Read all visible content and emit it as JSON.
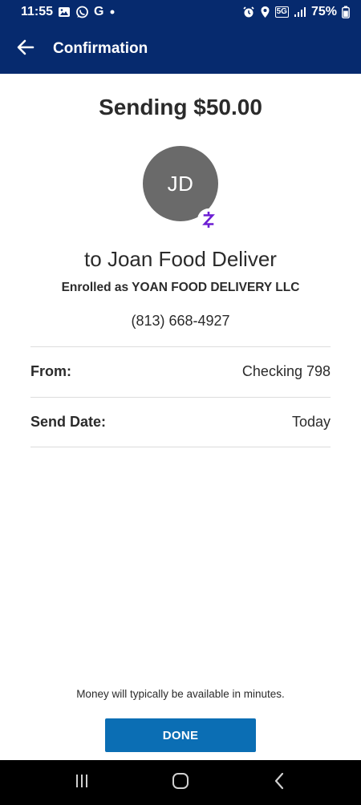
{
  "status_bar": {
    "time": "11:55",
    "left_icons": [
      "gallery-icon",
      "whatsapp-icon",
      "google-icon",
      "dot-icon"
    ],
    "google_letter": "G",
    "network_label": "5G",
    "battery": "75%"
  },
  "app_bar": {
    "title": "Confirmation"
  },
  "confirmation": {
    "amount_title": "Sending $50.00",
    "avatar_initials": "JD",
    "recipient": "to Joan Food Deliver",
    "enrolled_as": "Enrolled as YOAN FOOD DELIVERY LLC",
    "phone": "(813) 668-4927"
  },
  "details": [
    {
      "label": "From:",
      "value": "Checking 798"
    },
    {
      "label": "Send Date:",
      "value": "Today"
    }
  ],
  "footer": {
    "note": "Money will typically be available in minutes.",
    "done_label": "DONE"
  },
  "colors": {
    "header": "#062a6e",
    "button": "#0b6eb4",
    "avatar": "#6a6a6a",
    "zelle": "#6d1ed4"
  }
}
